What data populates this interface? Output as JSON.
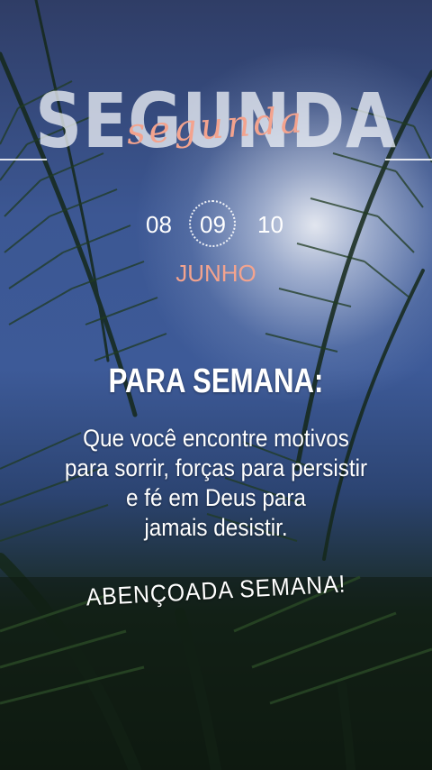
{
  "header": {
    "day_big": "SEGUNDA",
    "day_script": "segunda"
  },
  "dates": {
    "previous": "08",
    "current": "09",
    "next": "10",
    "month": "JUNHO"
  },
  "message": {
    "heading": "PARA SEMANA:",
    "lines": [
      "Que você encontre motivos",
      "para sorrir, forças para persistir",
      "e fé em Deus para",
      "jamais desistir."
    ],
    "closing": "ABENÇOADA SEMANA!"
  },
  "colors": {
    "accent": "#f3a38e",
    "text": "#ffffff",
    "sky": "#3d5a98",
    "foliage": "#1a2e1c"
  }
}
